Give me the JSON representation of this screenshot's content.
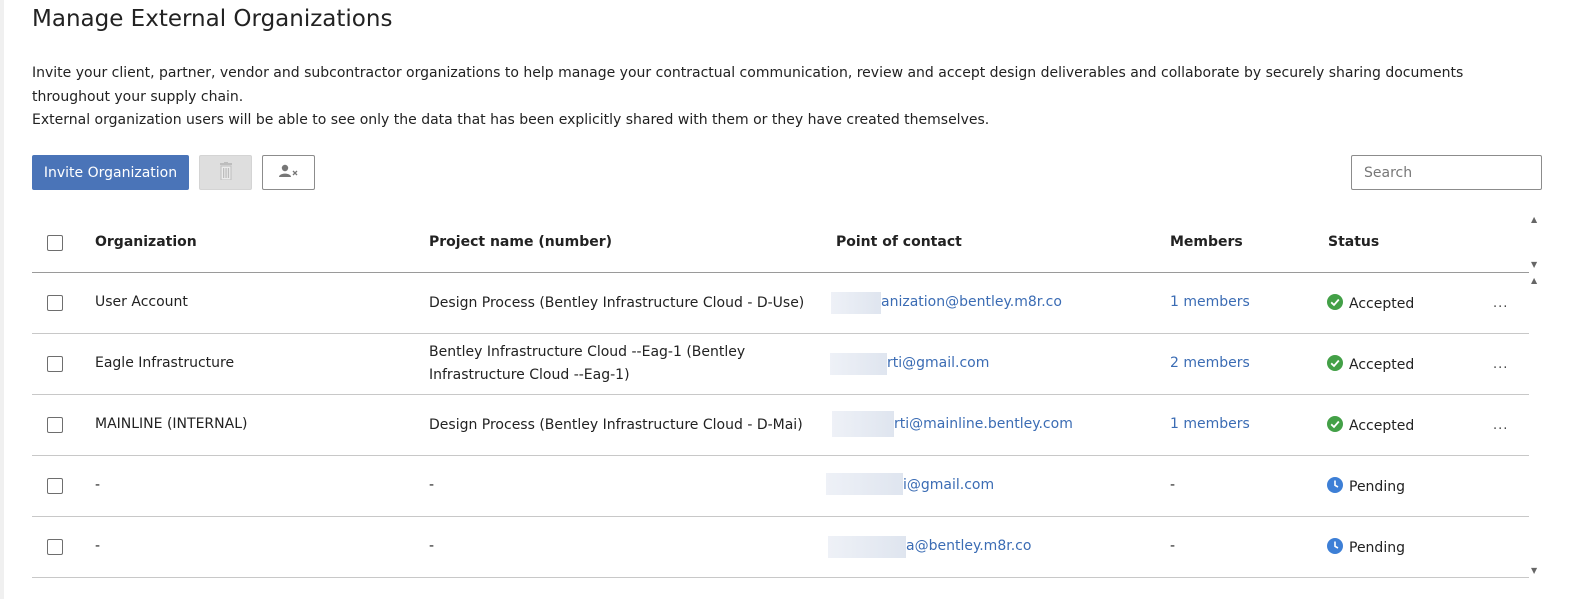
{
  "page": {
    "title": "Manage External Organizations",
    "description_1": "Invite your client, partner, vendor and subcontractor organizations to help manage your contractual communication, review and accept design deliverables and collaborate by securely sharing documents throughout your supply chain.",
    "description_2": "External organization users will be able to see only the data that has been explicitly shared with them or they have created themselves."
  },
  "toolbar": {
    "invite_label": "Invite Organization",
    "delete_icon": "trash-icon",
    "remove_icon": "user-remove-icon",
    "search_placeholder": "Search"
  },
  "table": {
    "headers": {
      "organization": "Organization",
      "project": "Project name (number)",
      "contact": "Point of contact",
      "members": "Members",
      "status": "Status"
    },
    "rows": [
      {
        "organization": "User Account",
        "project": "Design Process (Bentley Infrastructure Cloud - D-Use)",
        "contact": "anization@bentley.m8r.co",
        "members": "1 members",
        "status": "Accepted",
        "more": "..."
      },
      {
        "organization": "Eagle Infrastructure",
        "project": "Bentley Infrastructure Cloud --Eag-1 (Bentley Infrastructure Cloud --Eag-1)",
        "contact": "rti@gmail.com",
        "members": "2 members",
        "status": "Accepted",
        "more": "..."
      },
      {
        "organization": "MAINLINE (INTERNAL)",
        "project": "Design Process (Bentley Infrastructure Cloud - D-Mai)",
        "contact": "rti@mainline.bentley.com",
        "members": "1 members",
        "status": "Accepted",
        "more": "..."
      },
      {
        "organization": "-",
        "project": "-",
        "contact": "i@gmail.com",
        "members": "-",
        "status": "Pending",
        "more": ""
      },
      {
        "organization": "-",
        "project": "-",
        "contact": "a@bentley.m8r.co",
        "members": "-",
        "status": "Pending",
        "more": ""
      }
    ]
  },
  "colors": {
    "primary": "#4a74b8",
    "link": "#3b6cb4",
    "accepted": "#43a047",
    "pending": "#3d7fd6"
  }
}
